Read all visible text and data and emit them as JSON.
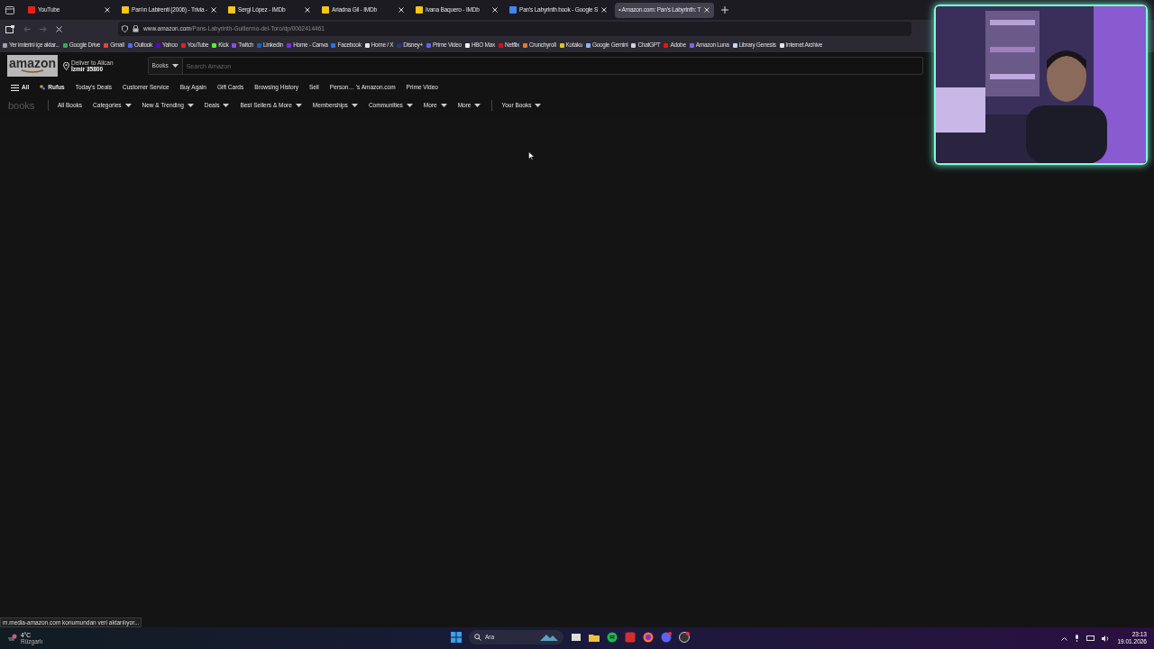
{
  "tabs": [
    {
      "title": "YouTube",
      "selected": false,
      "color": "#e62117"
    },
    {
      "title": "Pan'ın Labirenti (2006) - Trivia -",
      "selected": false,
      "color": "#f5c518"
    },
    {
      "title": "Sergi López - IMDb",
      "selected": false,
      "color": "#f5c518"
    },
    {
      "title": "Ariadna Gil - IMDb",
      "selected": false,
      "color": "#f5c518"
    },
    {
      "title": "Ivana Baquero - IMDb",
      "selected": false,
      "color": "#f5c518"
    },
    {
      "title": "Pan's Labyrinth book - Google S",
      "selected": false,
      "color": "#4285f4"
    },
    {
      "title": "• Amazon.com: Pan's Labyrinth: T",
      "selected": true
    }
  ],
  "address": {
    "host": "www.amazon.com",
    "path": "/Pans-Labyrinth-Guillermo-del-Toro/dp/0062414461"
  },
  "bookmarks": [
    {
      "label": "Yer imlerini içe aktar...",
      "color": "#9ca3af"
    },
    {
      "label": "Google Drive",
      "color": "#34a853"
    },
    {
      "label": "Gmail",
      "color": "#ea4335"
    },
    {
      "label": "Outlook",
      "color": "#4f6bed"
    },
    {
      "label": "Yahoo",
      "color": "#6001d2"
    },
    {
      "label": "YouTube",
      "color": "#e62117"
    },
    {
      "label": "Kick",
      "color": "#53fc18"
    },
    {
      "label": "Twitch",
      "color": "#9146ff"
    },
    {
      "label": "LinkedIn",
      "color": "#0a66c2"
    },
    {
      "label": "Home - Canva",
      "color": "#7d2ae8"
    },
    {
      "label": "Facebook",
      "color": "#1877f2"
    },
    {
      "label": "Home / X",
      "color": "#e5e7eb"
    },
    {
      "label": "Disney+",
      "color": "#1e3a8a"
    },
    {
      "label": "Prime Video",
      "color": "#6366f1"
    },
    {
      "label": "HBO Max",
      "color": "#f3f4f6"
    },
    {
      "label": "Netflix",
      "color": "#e50914"
    },
    {
      "label": "Crunchyroll",
      "color": "#f47521"
    },
    {
      "label": "Kotaku",
      "color": "#d9c522"
    },
    {
      "label": "Google Gemini",
      "color": "#8ab4f8"
    },
    {
      "label": "ChatGPT",
      "color": "#d1d5db"
    },
    {
      "label": "Adobe",
      "color": "#fa0f00"
    },
    {
      "label": "Amazon Luna",
      "color": "#8b5cf6"
    },
    {
      "label": "Library Genesis",
      "color": "#c7d2fe"
    },
    {
      "label": "Internet Archive",
      "color": "#e5e7eb"
    }
  ],
  "amazon": {
    "logo": "amazon",
    "deliver_line1": "Deliver to Alican",
    "deliver_line2": "İzmir 35800",
    "search_category": "Books",
    "search_placeholder": "Search Amazon",
    "nav": [
      "All",
      "Rufus",
      "Today's Deals",
      "Customer Service",
      "Buy Again",
      "Gift Cards",
      "Browsing History",
      "Sell",
      "Person… 's Amazon.com",
      "Prime Video"
    ],
    "books_logo": "books",
    "books_nav": [
      {
        "label": "All Books",
        "dropdown": false
      },
      {
        "label": "Categories",
        "dropdown": true
      },
      {
        "label": "New & Trending",
        "dropdown": true
      },
      {
        "label": "Deals",
        "dropdown": true
      },
      {
        "label": "Best Sellers & More",
        "dropdown": true
      },
      {
        "label": "Memberships",
        "dropdown": true
      },
      {
        "label": "Communities",
        "dropdown": true
      },
      {
        "label": "More",
        "dropdown": true
      },
      {
        "label": "More",
        "dropdown": true
      },
      {
        "label": "Your Books",
        "dropdown": true
      }
    ]
  },
  "status_text": "m.media-amazon.com konumundan veri aktarılıyor...",
  "taskbar": {
    "weather_temp": "4°C",
    "weather_label": "Rüzgarlı",
    "search": "Ara",
    "time": "23:13",
    "date": "19.01.2026"
  }
}
